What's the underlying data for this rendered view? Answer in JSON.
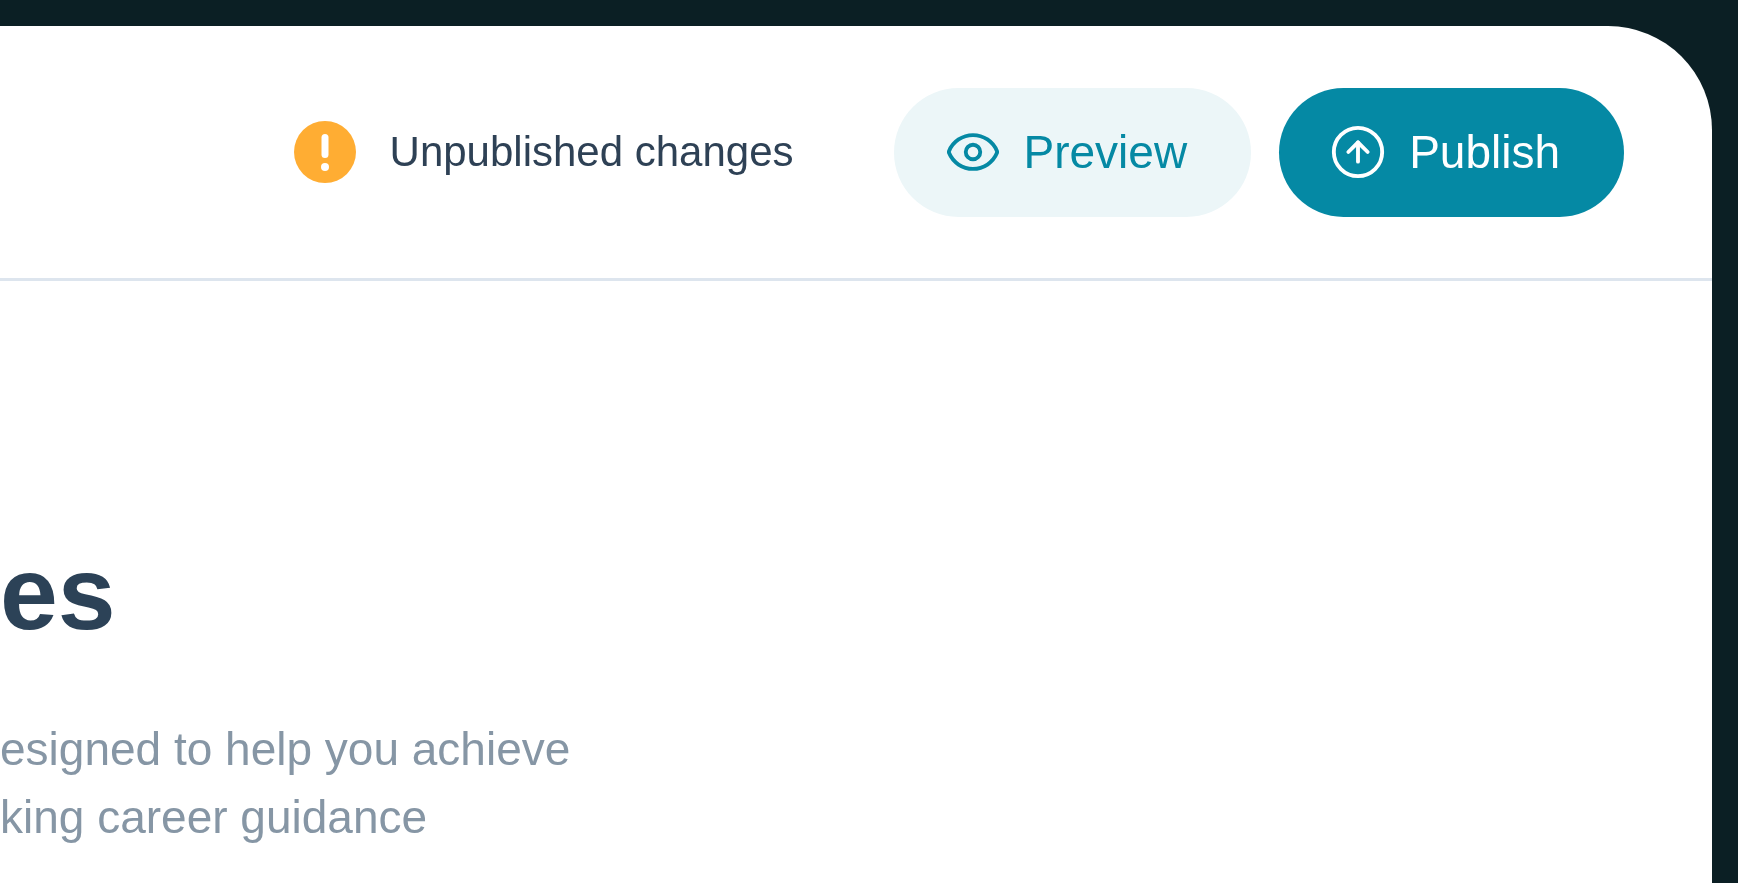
{
  "status": {
    "text": "Unpublished changes",
    "kind": "warning"
  },
  "buttons": [
    {
      "label": "Preview",
      "kind": "secondary"
    },
    {
      "label": "Publish",
      "kind": "primary"
    }
  ],
  "heading": "es",
  "description": [
    "esigned to help you achieve",
    "king career guidance"
  ]
}
